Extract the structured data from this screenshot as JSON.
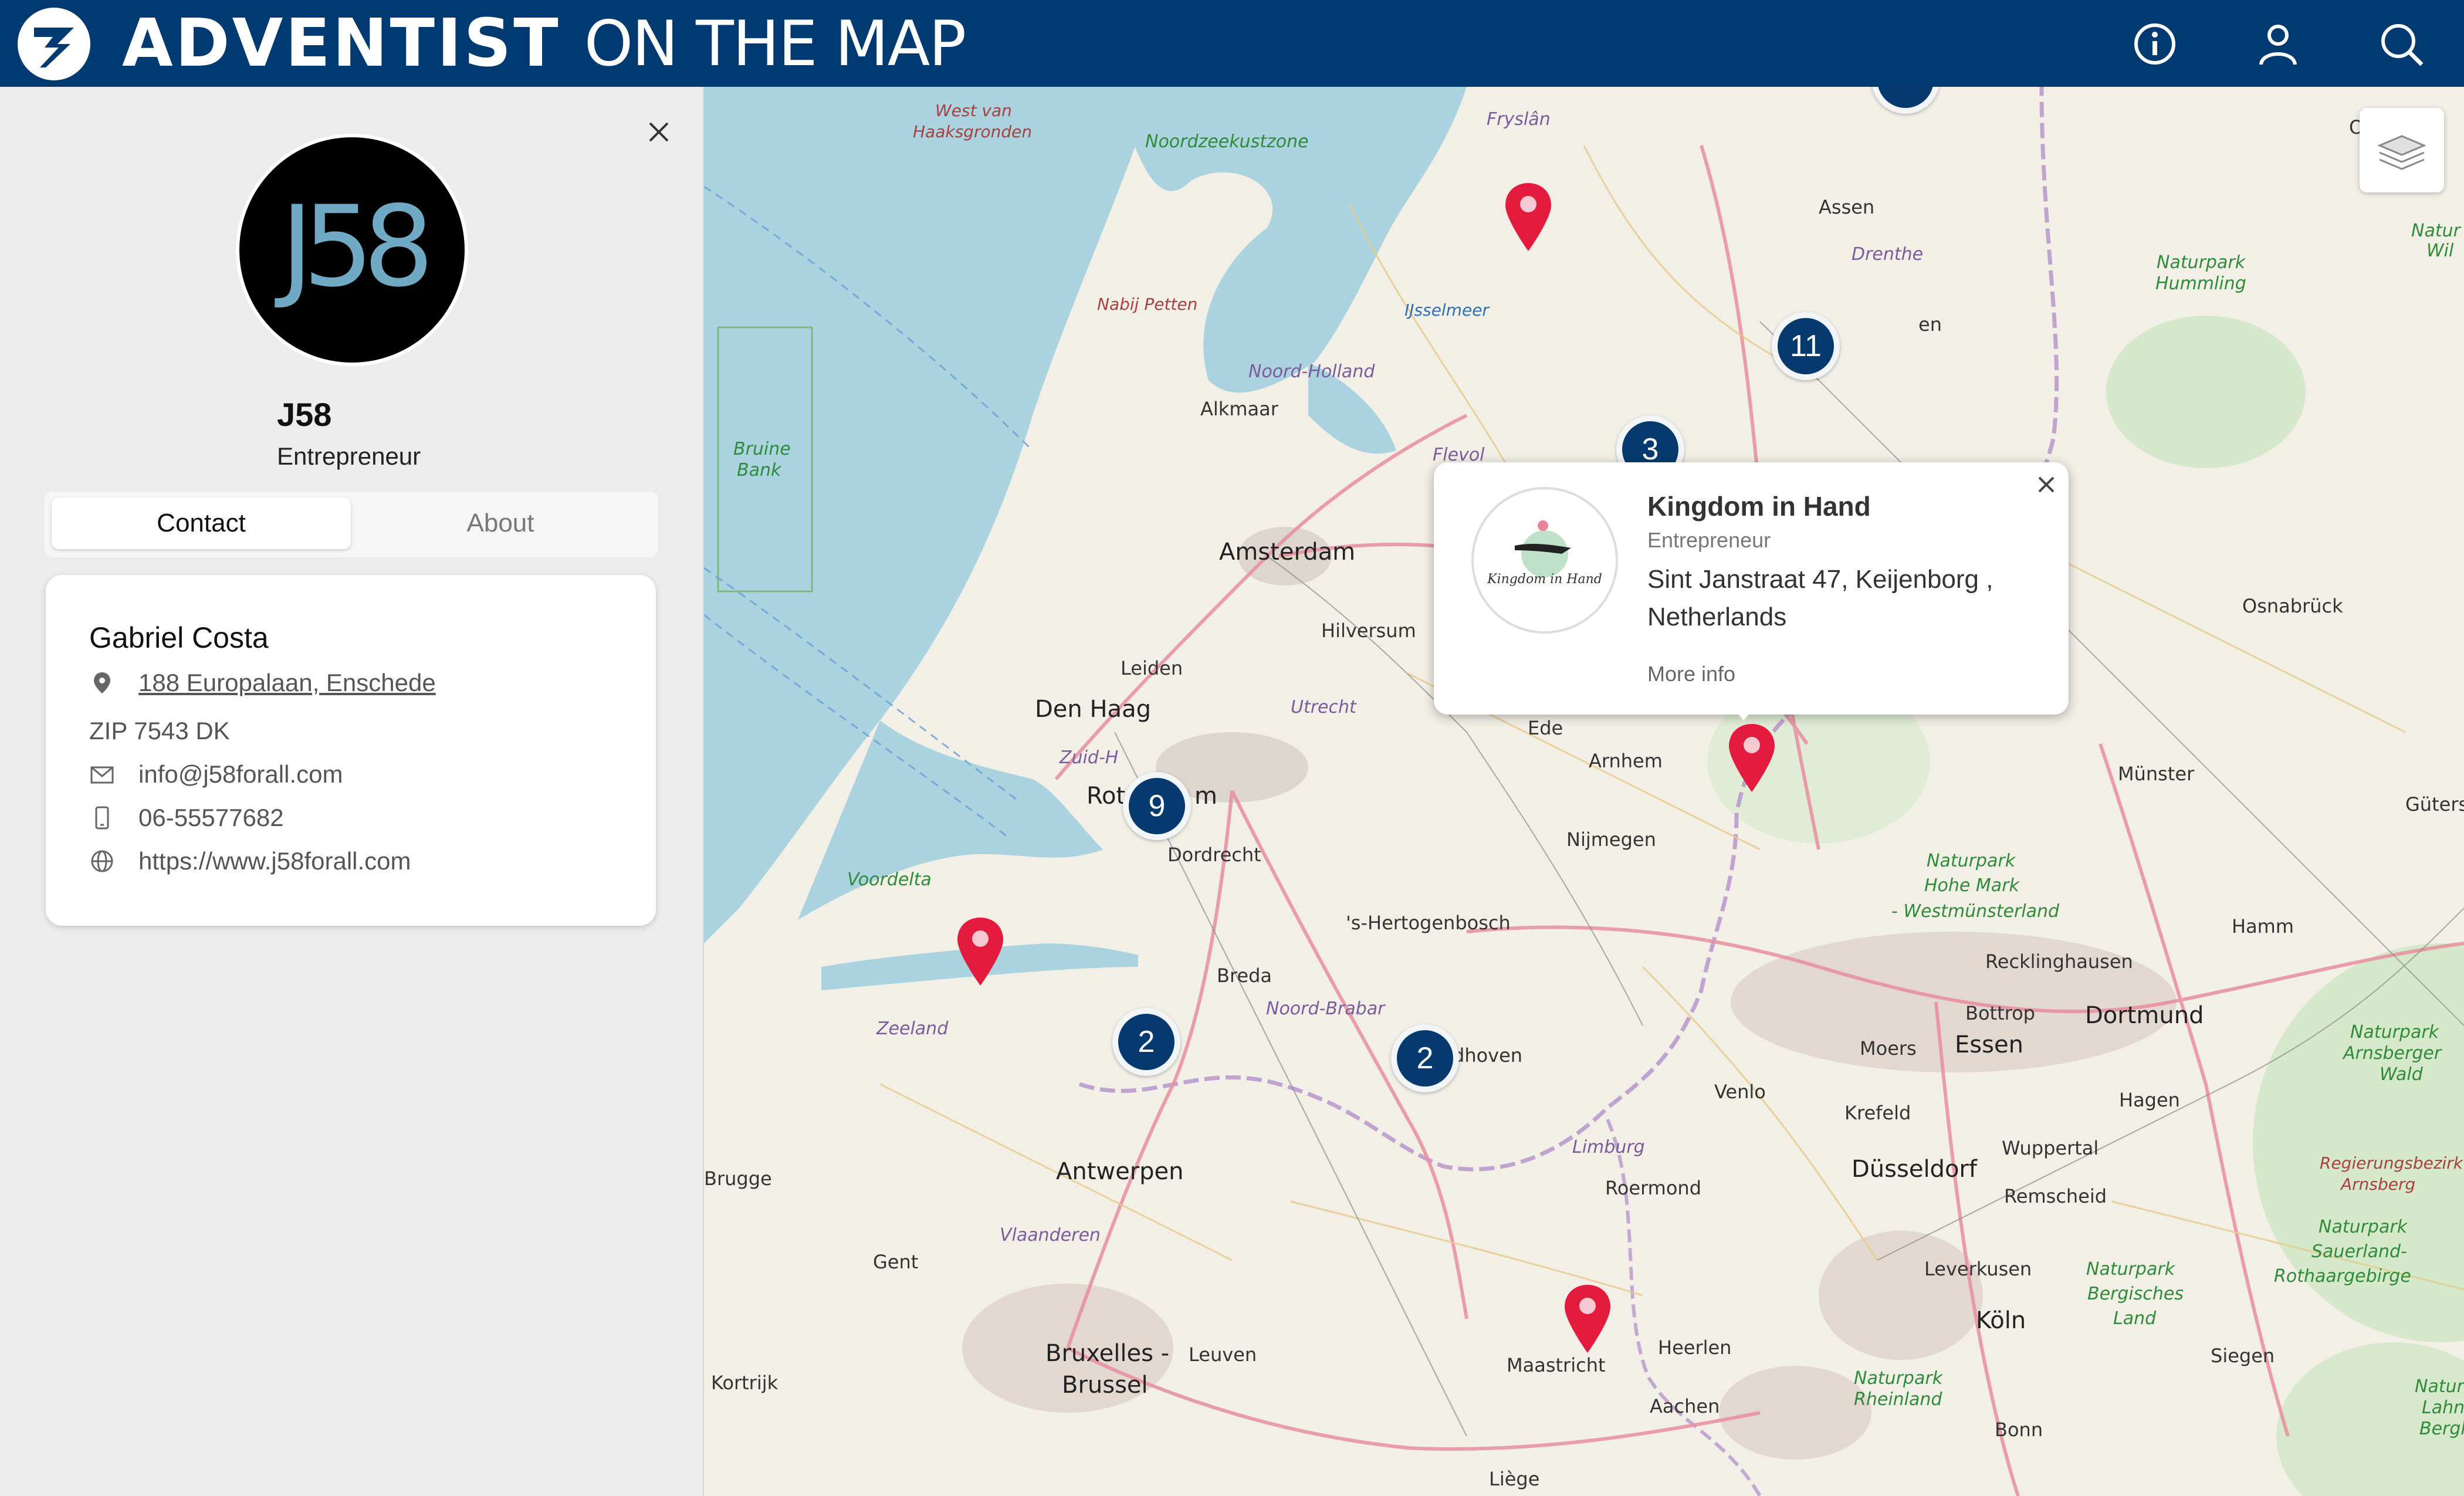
{
  "header": {
    "brand_bold": "ADVENTIST",
    "brand_light": "ON THE MAP",
    "icons": [
      "info-icon",
      "user-icon",
      "search-icon"
    ],
    "colors": {
      "bar": "#003a70"
    }
  },
  "profile": {
    "logo_text": "J58",
    "name": "J58",
    "role": "Entrepreneur"
  },
  "tabs": [
    "Contact",
    "About"
  ],
  "contact": {
    "person": "Gabriel Costa",
    "address": "188 Europalaan, Enschede",
    "zip": "ZIP 7543 DK",
    "email": "info@j58forall.com",
    "phone": "06-55577682",
    "website": "https://www.j58forall.com"
  },
  "map": {
    "clusters": [
      "11",
      "3",
      "9",
      "2",
      "2"
    ],
    "labels": {
      "west_van": "West van",
      "haaksgronden": "Haaksgronden",
      "noordzeekustzone": "Noordzeekustzone",
      "fryslan": "Fryslân",
      "assen": "Assen",
      "drenthe": "Drenthe",
      "nabij_petten": "Nabij Petten",
      "ijsselmeer": "IJsselmeer",
      "noord_holland": "Noord-Holland",
      "alkmaar": "Alkmaar",
      "bruine": "Bruine",
      "bank": "Bank",
      "flevoland": "Flevol",
      "amsterdam": "Amsterdam",
      "hilversum": "Hilversum",
      "leiden": "Leiden",
      "den_haag": "Den Haag",
      "utrecht": "Utrecht",
      "ede": "Ede",
      "arnhem": "Arnhem",
      "zuid_h": "Zuid-H",
      "rotterdam_a": "Rot",
      "rotterdam_b": "m",
      "dordrecht": "Dordrecht",
      "nijmegen": "Nijmegen",
      "voordelta": "Voordelta",
      "breda": "Breda",
      "hertogenbosch": "'s-Hertogenbosch",
      "noord_brabant": "Noord-Brabar",
      "eindhoven": "dhoven",
      "zeeland": "Zeeland",
      "naturpark_hohe_mark": "Naturpark",
      "hohe_mark_2": "Hohe Mark",
      "westmunsterland": "- Westmünsterland",
      "recklinghausen": "Recklinghausen",
      "bottrop": "Bottrop",
      "essen": "Essen",
      "dortmund": "Dortmund",
      "moers": "Moers",
      "venlo": "Venlo",
      "krefeld": "Krefeld",
      "hagen": "Hagen",
      "limburg": "Limburg",
      "roermond": "Roermond",
      "dusseldorf": "Düsseldorf",
      "wuppertal": "Wuppertal",
      "remscheid": "Remscheid",
      "brugge": "Brugge",
      "antwerpen": "Antwerpen",
      "vlaanderen": "Vlaanderen",
      "gent": "Gent",
      "leverkusen": "Leverkusen",
      "koln": "Köln",
      "bruxelles": "Bruxelles -",
      "brussel": "Brussel",
      "leuven": "Leuven",
      "kortrijk": "Kortrijk",
      "maastricht": "Maastricht",
      "heerlen": "Heerlen",
      "aachen": "Aachen",
      "liege": "Liège",
      "bonn": "Bonn",
      "siegen": "Siegen",
      "osnabruck": "Osnabrück",
      "munster": "Münster",
      "guters": "Güters",
      "hamm": "Hamm",
      "naturpark_hummling_1": "Naturpark",
      "naturpark_hummling_2": "Hummling",
      "arnsberger_1": "Naturpark",
      "arnsberger_2": "Arnsberger",
      "arnsberger_3": "Wald",
      "regierungsbezirk": "Regierungsbezirk",
      "arnsberg": "Arnsberg",
      "sauerland_1": "Naturpark",
      "sauerland_2": "Sauerland-",
      "sauerland_3": "Rothaargebirge",
      "bergisches_1": "Naturpark",
      "bergisches_2": "Bergisches",
      "bergisches_3": "Land",
      "rheinland_1": "Naturpark",
      "rheinland_2": "Rheinland",
      "lahn_1": "Natur",
      "lahn_2": "Lahn-",
      "lahn_3": "Bergl",
      "wil_1": "Natur",
      "wil_2": "Wil",
      "edge_o": "O",
      "en_partial": "en"
    }
  },
  "popup": {
    "title": "Kingdom in Hand",
    "category": "Entrepreneur",
    "address": "Sint Janstraat 47, Keijenborg , Netherlands",
    "link": "More info",
    "logo_script": "Kingdom in Hand"
  }
}
